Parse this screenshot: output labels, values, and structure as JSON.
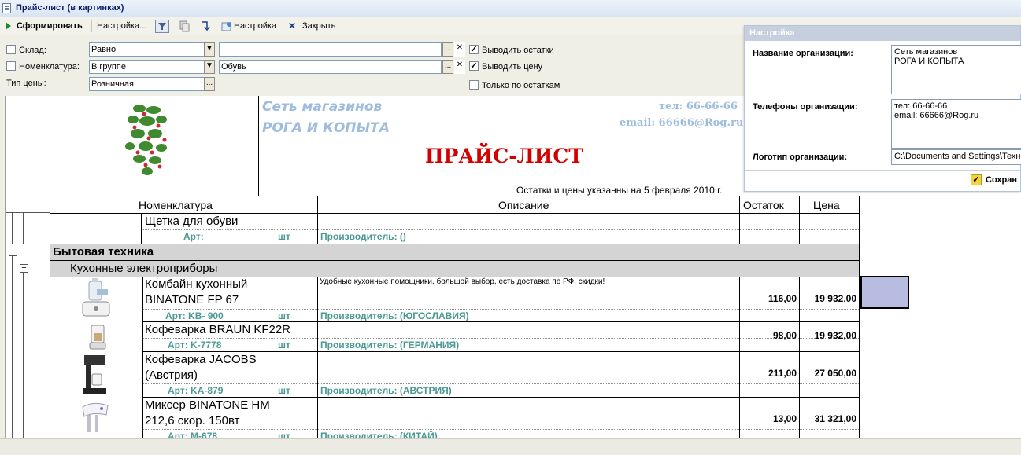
{
  "window": {
    "title": "Прайс-лист (в картинках)"
  },
  "toolbar": {
    "generate": "Сформировать",
    "settings1": "Настройка...",
    "settings2": "Настройка",
    "close": "Закрыть"
  },
  "filters": {
    "warehouse": {
      "label": "Склад:",
      "condition": "Равно",
      "value": ""
    },
    "nomenclature": {
      "label": "Номенклатура:",
      "condition": "В группе",
      "value": "Обувь"
    },
    "price_type": {
      "label": "Тип цены:",
      "value": "Розничная"
    },
    "show_stock": "Выводить остатки",
    "show_price": "Выводить цену",
    "only_stock": "Только по остаткам"
  },
  "report": {
    "org_name_line1": "Сеть магазинов",
    "org_name_line2": "РОГА И КОПЫТА",
    "phone": "тел:   66-66-66",
    "email": "email: 66666@Rog.ru",
    "title": "ПРАЙС-ЛИСТ",
    "date_note": "Остатки и цены указанны на 5 февраля 2010 г.",
    "columns": [
      "Номенклатура",
      "Описание",
      "Остаток",
      "Цена"
    ],
    "brush": {
      "name": "Щетка для обуви",
      "art": "Арт:",
      "unit": "шт",
      "maker": "Производитель:  ()"
    },
    "group1": "Бытовая техника",
    "group2": "Кухонные электроприборы",
    "items": [
      {
        "name1": "Комбайн кухонный",
        "name2": "BINATONE FP 67",
        "desc": "Удобные кухонные помощники, большой выбор, есть доставка по РФ, скидки!",
        "art": "Арт: KB- 900",
        "unit": "шт",
        "maker": "Производитель:  (ЮГОСЛАВИЯ)",
        "stock": "116,00",
        "price": "19 932,00"
      },
      {
        "name1": "Кофеварка BRAUN KF22R",
        "name2": "",
        "desc": "",
        "art": "Арт: K-7778",
        "unit": "шт",
        "maker": "Производитель:  (ГЕРМАНИЯ)",
        "stock": "98,00",
        "price": "19 932,00"
      },
      {
        "name1": "Кофеварка JACOBS",
        "name2": "(Австрия)",
        "desc": "",
        "art": "Арт: KA-879",
        "unit": "шт",
        "maker": "Производитель:  (АВСТРИЯ)",
        "stock": "211,00",
        "price": "27 050,00"
      },
      {
        "name1": "Миксер BINATONE HM",
        "name2": "212,6 скор. 150вт",
        "desc": "",
        "art": "Арт: M-678",
        "unit": "шт",
        "maker": "Производитель:  (КИТАЙ)",
        "stock": "13,00",
        "price": "31 321,00"
      }
    ]
  },
  "settings_panel": {
    "header": "Настройка",
    "org_name_label": "Название организации:",
    "org_name_value1": "Сеть магазинов",
    "org_name_value2": "РОГА И КОПЫТА",
    "phones_label": "Телефоны организации:",
    "phones_value1": "тел:   66-66-66",
    "phones_value2": "email: 66666@Rog.ru",
    "logo_label": "Логотип организации:",
    "logo_value": "C:\\Documents and Settings\\Техн",
    "save": "Сохран"
  },
  "colors": {
    "title_red": "#d20000",
    "org_blue": "#9ebcdc",
    "teal": "#4a9a94",
    "group_bg": "#d4d4d4",
    "selected_cell": "#b8bce0"
  }
}
